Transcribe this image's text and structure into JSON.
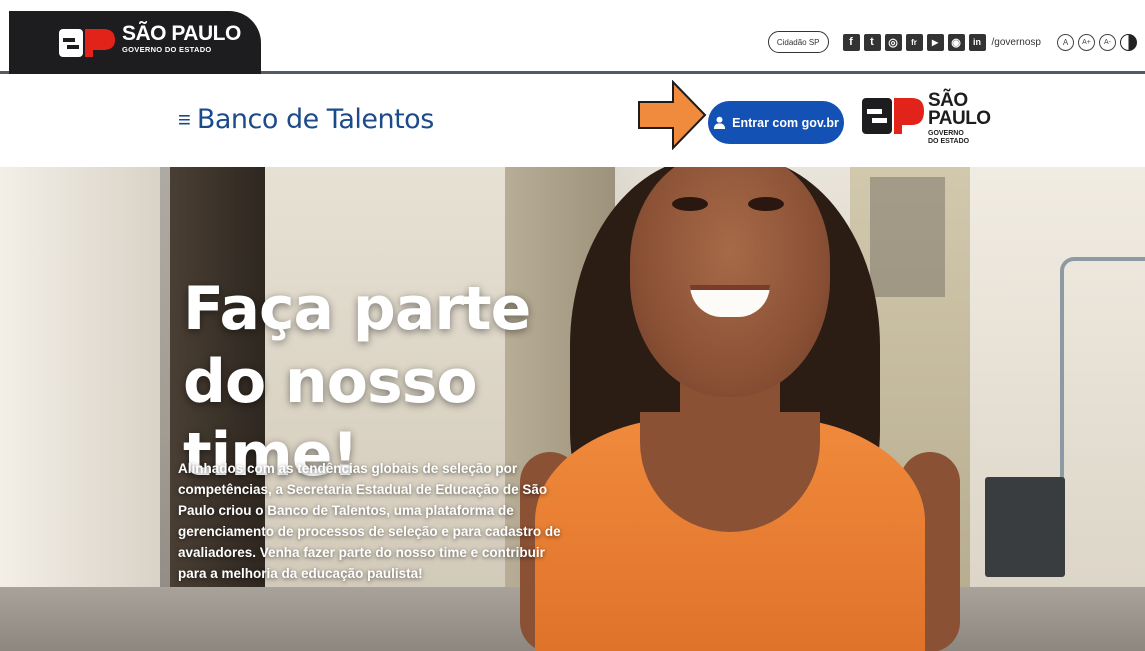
{
  "top_bar": {
    "logo": {
      "title": "SÃO PAULO",
      "subtitle": "GOVERNO DO ESTADO"
    },
    "cidadao_label": "Cidadão SP",
    "social": [
      {
        "icon": "facebook-icon",
        "glyph": "f"
      },
      {
        "icon": "twitter-icon",
        "glyph": "t"
      },
      {
        "icon": "instagram-icon",
        "glyph": "◎"
      },
      {
        "icon": "flickr-icon",
        "glyph": "fr"
      },
      {
        "icon": "youtube-icon",
        "glyph": "▶"
      },
      {
        "icon": "issuu-icon",
        "glyph": "◉"
      },
      {
        "icon": "linkedin-icon",
        "glyph": "in"
      }
    ],
    "social_handle": "/governosp",
    "accessibility": {
      "normal": "A",
      "increase": "A+",
      "decrease": "A-"
    }
  },
  "header": {
    "menu_icon": "≡",
    "title": "Banco de Talentos",
    "login_button": "Entrar com gov.br",
    "logo": {
      "line1": "SÃO",
      "line2": "PAULO",
      "line3": "GOVERNO",
      "line4": "DO ESTADO"
    }
  },
  "hero": {
    "title": "Faça parte do nosso time!",
    "description": "Alinhados com as tendências globais de seleção por competências, a Secretaria Estadual de Educação de São Paulo criou o Banco de Talentos, uma plataforma de gerenciamento de processos de seleção e para cadastro de avaliadores. Venha fazer parte do nosso time e contribuir para a melhoria da educação paulista!"
  },
  "colors": {
    "brand_blue": "#1351b4",
    "title_blue": "#1b4b8a",
    "sp_red": "#e2231a",
    "arrow_orange": "#f08a3c"
  }
}
